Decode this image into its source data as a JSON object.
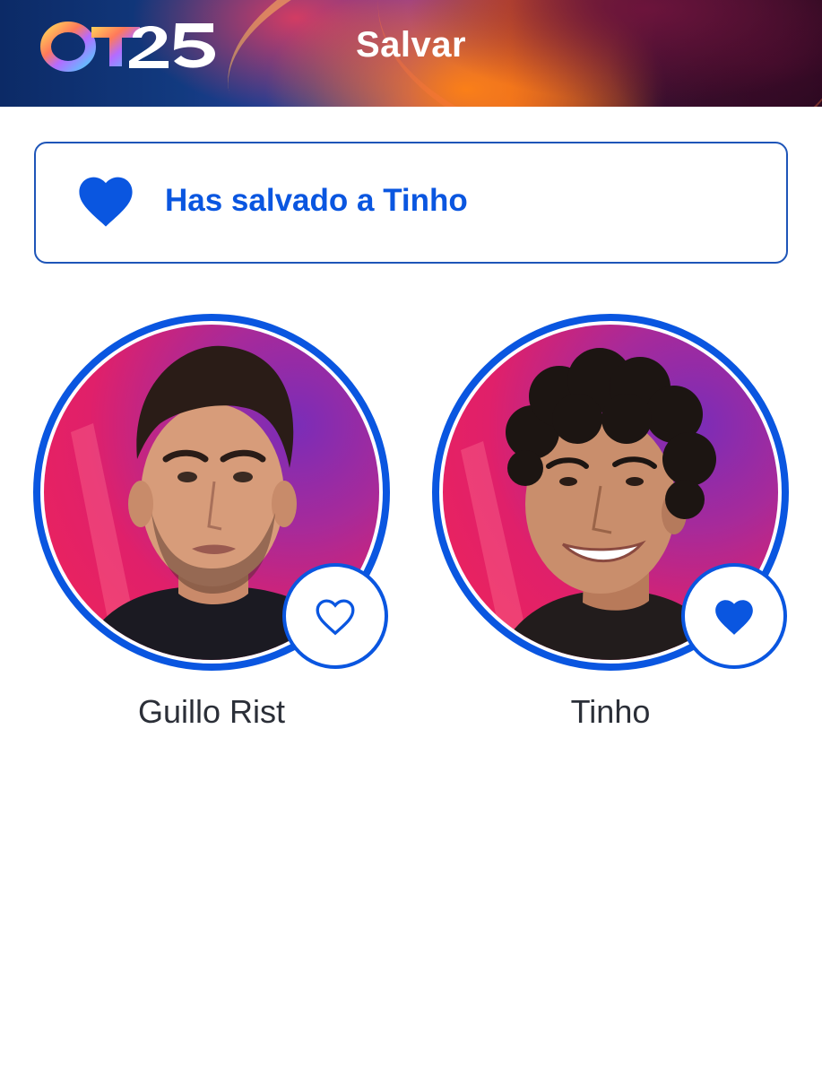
{
  "header": {
    "logo_text": "OT25",
    "title": "Salvar"
  },
  "banner": {
    "icon": "heart-filled-icon",
    "message": "Has salvado a Tinho"
  },
  "contestants": [
    {
      "name": "Guillo Rist",
      "saved": false,
      "icon": "heart-outline-icon"
    },
    {
      "name": "Tinho",
      "saved": true,
      "icon": "heart-filled-icon"
    }
  ],
  "colors": {
    "accent": "#0a56e0",
    "text": "#2b2f38",
    "banner_border": "#1e55b8"
  }
}
